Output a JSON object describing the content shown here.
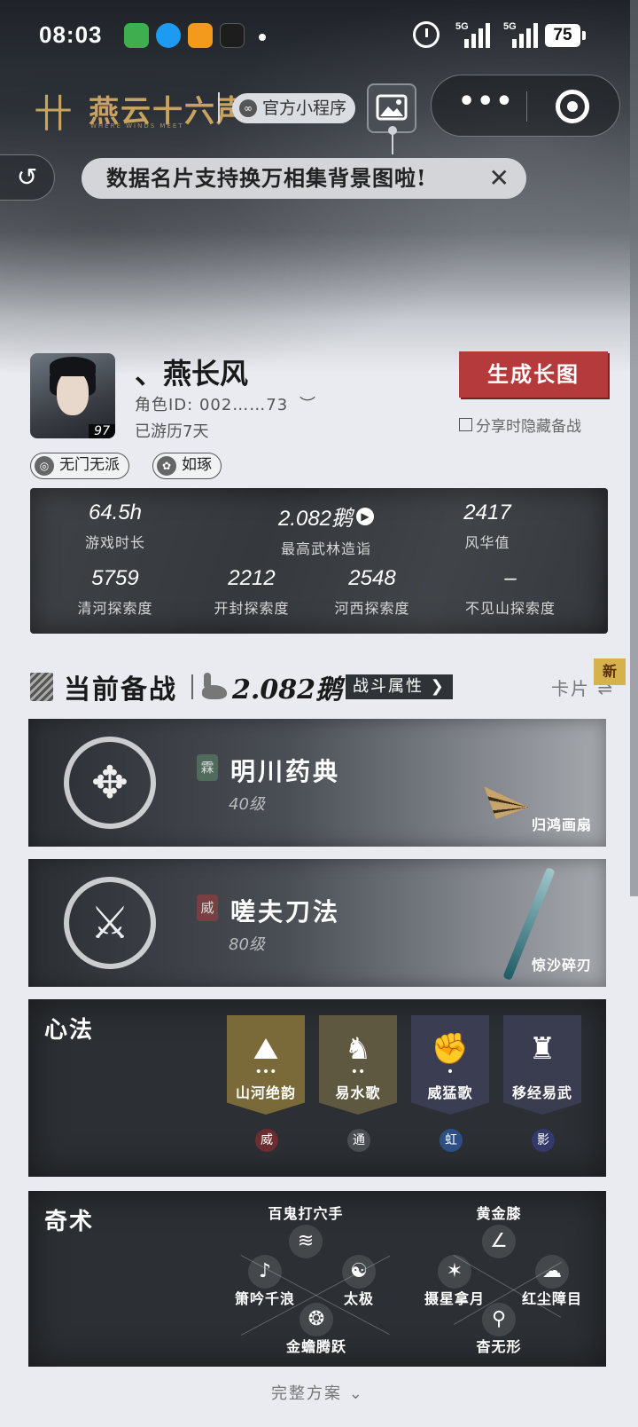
{
  "status_bar": {
    "time": "08:03",
    "signal_1_label": "5G",
    "signal_2_label": "5G",
    "battery": "75"
  },
  "header": {
    "logo_mark": "卄",
    "logo_text": "燕云十六声",
    "logo_sub": "WHERE WINDS MEET",
    "official_label": "官方小程序"
  },
  "tooltip": {
    "text": "数据名片支持换万相集背景图啦!",
    "close": "✕"
  },
  "profile": {
    "avatar_level": "97",
    "name": "、燕长风",
    "role_id": "角色ID: 002……73",
    "played_days": "已游历7天",
    "generate_button": "生成长图",
    "hide_option": "分享时隐藏备战",
    "tags": [
      {
        "icon": "school-icon",
        "label": "无门无派"
      },
      {
        "icon": "lotus-icon",
        "label": "如琢"
      }
    ]
  },
  "stats": [
    {
      "value": "64.5h",
      "label": "游戏时长"
    },
    {
      "value": "2.082鹅",
      "label": "最高武林造诣"
    },
    {
      "value": "2417",
      "label": "风华值"
    },
    {
      "value": "5759",
      "label": "清河探索度"
    },
    {
      "value": "2212",
      "label": "开封探索度"
    },
    {
      "value": "2548",
      "label": "河西探索度"
    },
    {
      "value": "–",
      "label": "不见山探索度"
    }
  ],
  "battle": {
    "title": "当前备战",
    "goose_value": "2.082鹅",
    "attr_button": "战斗属性",
    "card_view": "卡片",
    "new_badge": "新"
  },
  "skills": [
    {
      "seal": "霖",
      "seal_color": "#4f6b5c",
      "name": "明川药典",
      "level": "40级",
      "weapon": "归鸿画扇"
    },
    {
      "seal": "威",
      "seal_color": "#7a3f42",
      "name": "嗟夫刀法",
      "level": "80级",
      "weapon": "惊沙碎刃"
    }
  ],
  "xinfa": {
    "title": "心法",
    "items": [
      {
        "label": "山河绝韵",
        "seal": "威",
        "bg": "#7a6a3a",
        "seal_color": "#6b2d30"
      },
      {
        "label": "易水歌",
        "seal": "通",
        "bg": "#5f5840",
        "seal_color": "#4a4d52"
      },
      {
        "label": "威猛歌",
        "seal": "虹",
        "bg": "#3b3d52",
        "seal_color": "#2d4f86"
      },
      {
        "label": "移经易武",
        "seal": "影",
        "bg": "#3a3c50",
        "seal_color": "#34396b"
      }
    ]
  },
  "qishu": {
    "title": "奇术",
    "items": [
      "百鬼打穴手",
      "黄金膝",
      "箫吟千浪",
      "太极",
      "摄星拿月",
      "红尘障目",
      "金蟾腾跃",
      "杳无形"
    ]
  },
  "footer": {
    "full_plan": "完整方案"
  }
}
